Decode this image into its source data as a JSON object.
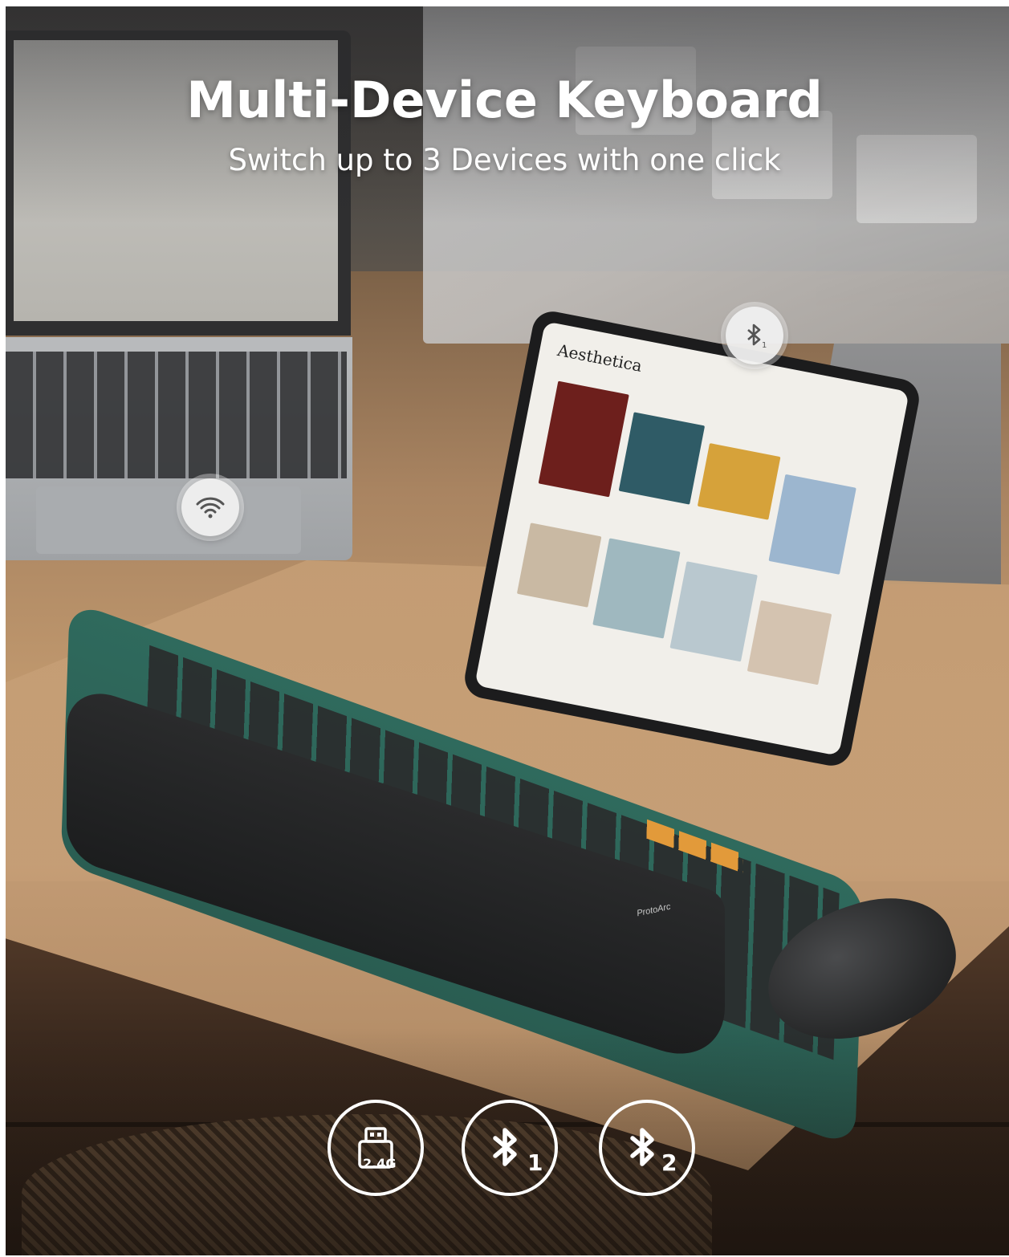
{
  "hero": {
    "title": "Multi-Device Keyboard",
    "subtitle": "Switch up to 3 Devices with one click"
  },
  "scene": {
    "tablet_app_title": "Aesthetica",
    "keyboard_brand": "ProtoArc",
    "badges": [
      {
        "icon": "wifi-icon",
        "device": "laptop"
      },
      {
        "icon": "bluetooth-1-icon",
        "device": "tablet",
        "number": "1"
      }
    ]
  },
  "connections": [
    {
      "icon": "usb-receiver-icon",
      "label": "2.4G"
    },
    {
      "icon": "bluetooth-icon",
      "channel": "1"
    },
    {
      "icon": "bluetooth-icon",
      "channel": "2"
    }
  ],
  "colors": {
    "keyboard_accent": "#2f6a5d",
    "orange_keys": "#e29a3a",
    "text": "#ffffff"
  }
}
